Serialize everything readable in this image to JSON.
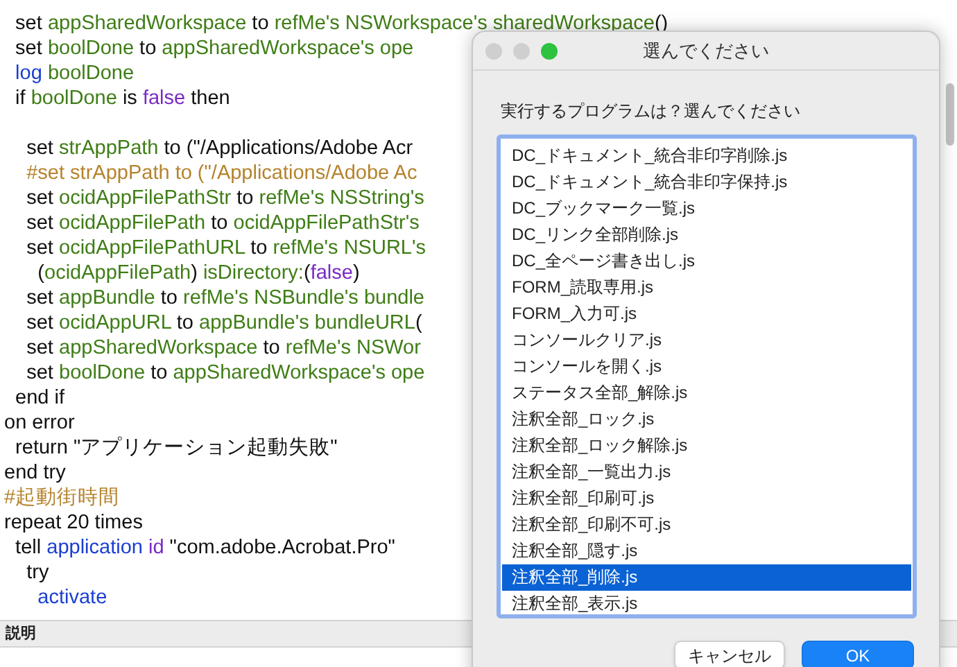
{
  "editor": {
    "lines": [
      {
        "kind": "code",
        "tokens": [
          {
            "text": "  set ",
            "kind": "plain"
          },
          {
            "text": "appSharedWorkspace",
            "kind": "var"
          },
          {
            "text": " to ",
            "kind": "plain"
          },
          {
            "text": "refMe's NSWorkspace's sharedWorkspace",
            "kind": "var"
          },
          {
            "text": "()",
            "kind": "plain"
          }
        ]
      },
      {
        "kind": "code",
        "tokens": [
          {
            "text": "  set ",
            "kind": "plain"
          },
          {
            "text": "boolDone",
            "kind": "var"
          },
          {
            "text": " to ",
            "kind": "plain"
          },
          {
            "text": "appSharedWorkspace's ope",
            "kind": "var"
          }
        ]
      },
      {
        "kind": "code",
        "tokens": [
          {
            "text": "  log ",
            "kind": "keyword"
          },
          {
            "text": "boolDone",
            "kind": "var"
          }
        ]
      },
      {
        "kind": "code",
        "tokens": [
          {
            "text": "  if ",
            "kind": "plain"
          },
          {
            "text": "boolDone",
            "kind": "var"
          },
          {
            "text": " is ",
            "kind": "plain"
          },
          {
            "text": "false",
            "kind": "constant"
          },
          {
            "text": " then",
            "kind": "plain"
          }
        ]
      },
      {
        "kind": "blank"
      },
      {
        "kind": "code",
        "tokens": [
          {
            "text": "    set ",
            "kind": "plain"
          },
          {
            "text": "strAppPath",
            "kind": "var"
          },
          {
            "text": " to (\"",
            "kind": "plain"
          },
          {
            "text": "/Applications/Adobe Acr",
            "kind": "plain"
          }
        ]
      },
      {
        "kind": "code",
        "tokens": [
          {
            "text": "    #set strAppPath to (\"/Applications/Adobe Ac",
            "kind": "comment"
          }
        ]
      },
      {
        "kind": "code",
        "tokens": [
          {
            "text": "    set ",
            "kind": "plain"
          },
          {
            "text": "ocidAppFilePathStr",
            "kind": "var"
          },
          {
            "text": " to ",
            "kind": "plain"
          },
          {
            "text": "refMe's NSString's",
            "kind": "var"
          }
        ]
      },
      {
        "kind": "code",
        "tokens": [
          {
            "text": "    set ",
            "kind": "plain"
          },
          {
            "text": "ocidAppFilePath",
            "kind": "var"
          },
          {
            "text": " to ",
            "kind": "plain"
          },
          {
            "text": "ocidAppFilePathStr's",
            "kind": "var"
          }
        ]
      },
      {
        "kind": "code",
        "tokens": [
          {
            "text": "    set ",
            "kind": "plain"
          },
          {
            "text": "ocidAppFilePathURL",
            "kind": "var"
          },
          {
            "text": " to ",
            "kind": "plain"
          },
          {
            "text": "refMe's NSURL's",
            "kind": "var"
          }
        ]
      },
      {
        "kind": "code",
        "tokens": [
          {
            "text": "      (",
            "kind": "plain"
          },
          {
            "text": "ocidAppFilePath",
            "kind": "var"
          },
          {
            "text": ") ",
            "kind": "plain"
          },
          {
            "text": "isDirectory:",
            "kind": "var"
          },
          {
            "text": "(",
            "kind": "plain"
          },
          {
            "text": "false",
            "kind": "constant"
          },
          {
            "text": ")",
            "kind": "plain"
          }
        ]
      },
      {
        "kind": "code",
        "tokens": [
          {
            "text": "    set ",
            "kind": "plain"
          },
          {
            "text": "appBundle",
            "kind": "var"
          },
          {
            "text": " to ",
            "kind": "plain"
          },
          {
            "text": "refMe's NSBundle's bundle",
            "kind": "var"
          }
        ]
      },
      {
        "kind": "code",
        "tokens": [
          {
            "text": "    set ",
            "kind": "plain"
          },
          {
            "text": "ocidAppURL",
            "kind": "var"
          },
          {
            "text": " to ",
            "kind": "plain"
          },
          {
            "text": "appBundle's bundleURL",
            "kind": "var"
          },
          {
            "text": "(",
            "kind": "plain"
          }
        ]
      },
      {
        "kind": "code",
        "tokens": [
          {
            "text": "    set ",
            "kind": "plain"
          },
          {
            "text": "appSharedWorkspace",
            "kind": "var"
          },
          {
            "text": " to ",
            "kind": "plain"
          },
          {
            "text": "refMe's NSWor",
            "kind": "var"
          }
        ]
      },
      {
        "kind": "code",
        "tokens": [
          {
            "text": "    set ",
            "kind": "plain"
          },
          {
            "text": "boolDone",
            "kind": "var"
          },
          {
            "text": " to ",
            "kind": "plain"
          },
          {
            "text": "appSharedWorkspace's ope",
            "kind": "var"
          }
        ]
      },
      {
        "kind": "code",
        "tokens": [
          {
            "text": "  end if",
            "kind": "plain"
          }
        ]
      },
      {
        "kind": "code",
        "tokens": [
          {
            "text": "on error",
            "kind": "plain"
          }
        ]
      },
      {
        "kind": "code",
        "tokens": [
          {
            "text": "  return \"アプリケーション起動失敗\"",
            "kind": "plain"
          }
        ]
      },
      {
        "kind": "code",
        "tokens": [
          {
            "text": "end try",
            "kind": "plain"
          }
        ]
      },
      {
        "kind": "code",
        "tokens": [
          {
            "text": "#起動街時間",
            "kind": "comment"
          }
        ]
      },
      {
        "kind": "code",
        "tokens": [
          {
            "text": "repeat 20 times",
            "kind": "plain"
          }
        ]
      },
      {
        "kind": "code",
        "tokens": [
          {
            "text": "  tell ",
            "kind": "plain"
          },
          {
            "text": "application ",
            "kind": "keyword"
          },
          {
            "text": "id",
            "kind": "constant"
          },
          {
            "text": " \"com.adobe.Acrobat.Pro\"",
            "kind": "plain"
          }
        ]
      },
      {
        "kind": "code",
        "tokens": [
          {
            "text": "    try",
            "kind": "plain"
          }
        ]
      },
      {
        "kind": "code",
        "tokens": [
          {
            "text": "      activate",
            "kind": "keyword"
          }
        ]
      }
    ]
  },
  "description_bar": {
    "label": "説明"
  },
  "dialog": {
    "title": "選んでください",
    "prompt": "実行するプログラムは？選んでください",
    "items": [
      {
        "label": "DC_ドキュメント_統合非印字削除.js",
        "selected": false
      },
      {
        "label": "DC_ドキュメント_統合非印字保持.js",
        "selected": false
      },
      {
        "label": "DC_ブックマーク一覧.js",
        "selected": false
      },
      {
        "label": "DC_リンク全部削除.js",
        "selected": false
      },
      {
        "label": "DC_全ページ書き出し.js",
        "selected": false
      },
      {
        "label": "FORM_読取専用.js",
        "selected": false
      },
      {
        "label": "FORM_入力可.js",
        "selected": false
      },
      {
        "label": "コンソールクリア.js",
        "selected": false
      },
      {
        "label": "コンソールを開く.js",
        "selected": false
      },
      {
        "label": "ステータス全部_解除.js",
        "selected": false
      },
      {
        "label": "注釈全部_ロック.js",
        "selected": false
      },
      {
        "label": "注釈全部_ロック解除.js",
        "selected": false
      },
      {
        "label": "注釈全部_一覧出力.js",
        "selected": false
      },
      {
        "label": "注釈全部_印刷可.js",
        "selected": false
      },
      {
        "label": "注釈全部_印刷不可.js",
        "selected": false
      },
      {
        "label": "注釈全部_隠す.js",
        "selected": false
      },
      {
        "label": "注釈全部_削除.js",
        "selected": true
      },
      {
        "label": "注釈全部_表示.js",
        "selected": false
      }
    ],
    "buttons": [
      {
        "label": "キャンセル",
        "kind": "secondary"
      },
      {
        "label": "OK",
        "kind": "primary"
      }
    ]
  }
}
